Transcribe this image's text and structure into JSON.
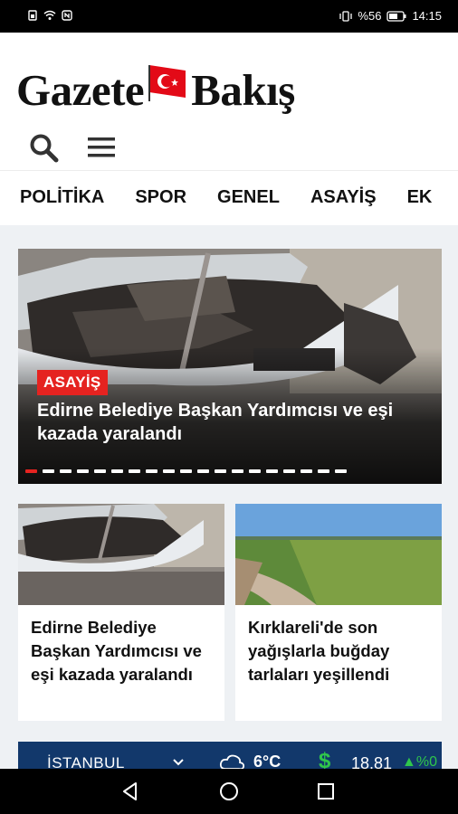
{
  "status_bar": {
    "battery": "%56",
    "time": "14:15"
  },
  "header": {
    "logo_left": "Gazete",
    "logo_right": "Bakış"
  },
  "nav": {
    "items": [
      "POLİTİKA",
      "SPOR",
      "GENEL",
      "ASAYİŞ",
      "EK"
    ]
  },
  "hero": {
    "badge": "ASAYİŞ",
    "title": "Edirne Belediye Başkan Yardımcısı ve eşi kazada yaralandı",
    "dot_count": 19,
    "active_dot": 0
  },
  "cards": [
    {
      "title": "Edirne Belediye Başkan Yardımcısı ve eşi kazada yaralandı"
    },
    {
      "title": "Kırklareli'de son yağışlarla buğday tarlaları yeşillendi"
    }
  ],
  "ticker": {
    "city": "İSTANBUL",
    "temperature": "6°C",
    "currency_symbol": "$",
    "rate": "18.81",
    "change": "▲%0"
  },
  "colors": {
    "accent": "#e52320",
    "ticker_bg": "#12386b",
    "up": "#2fc64b"
  },
  "icons": [
    "search-icon",
    "menu-icon",
    "cloud-icon",
    "back-icon",
    "home-icon",
    "recents-icon"
  ]
}
